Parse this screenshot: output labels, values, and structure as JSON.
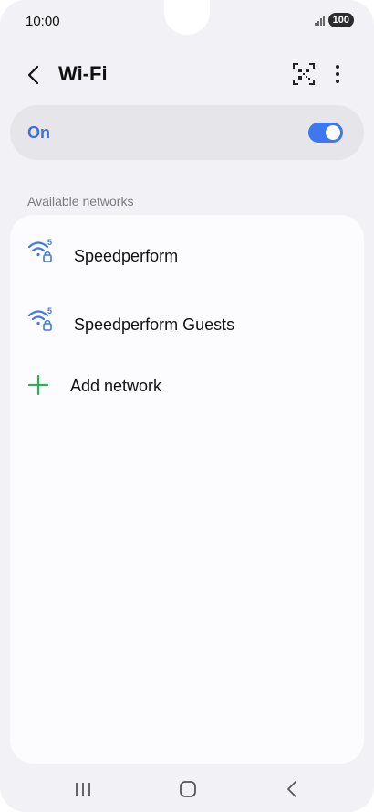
{
  "status_bar": {
    "time": "10:00",
    "battery": "100"
  },
  "header": {
    "title": "Wi-Fi"
  },
  "toggle": {
    "label": "On",
    "state": "on",
    "accent": "#3e77f0"
  },
  "networks": {
    "section_label": "Available networks",
    "items": [
      {
        "name": "Speedperform",
        "band_badge": "5",
        "secured": true
      },
      {
        "name": "Speedperform Guests",
        "band_badge": "5",
        "secured": true
      }
    ],
    "add_label": "Add network"
  }
}
